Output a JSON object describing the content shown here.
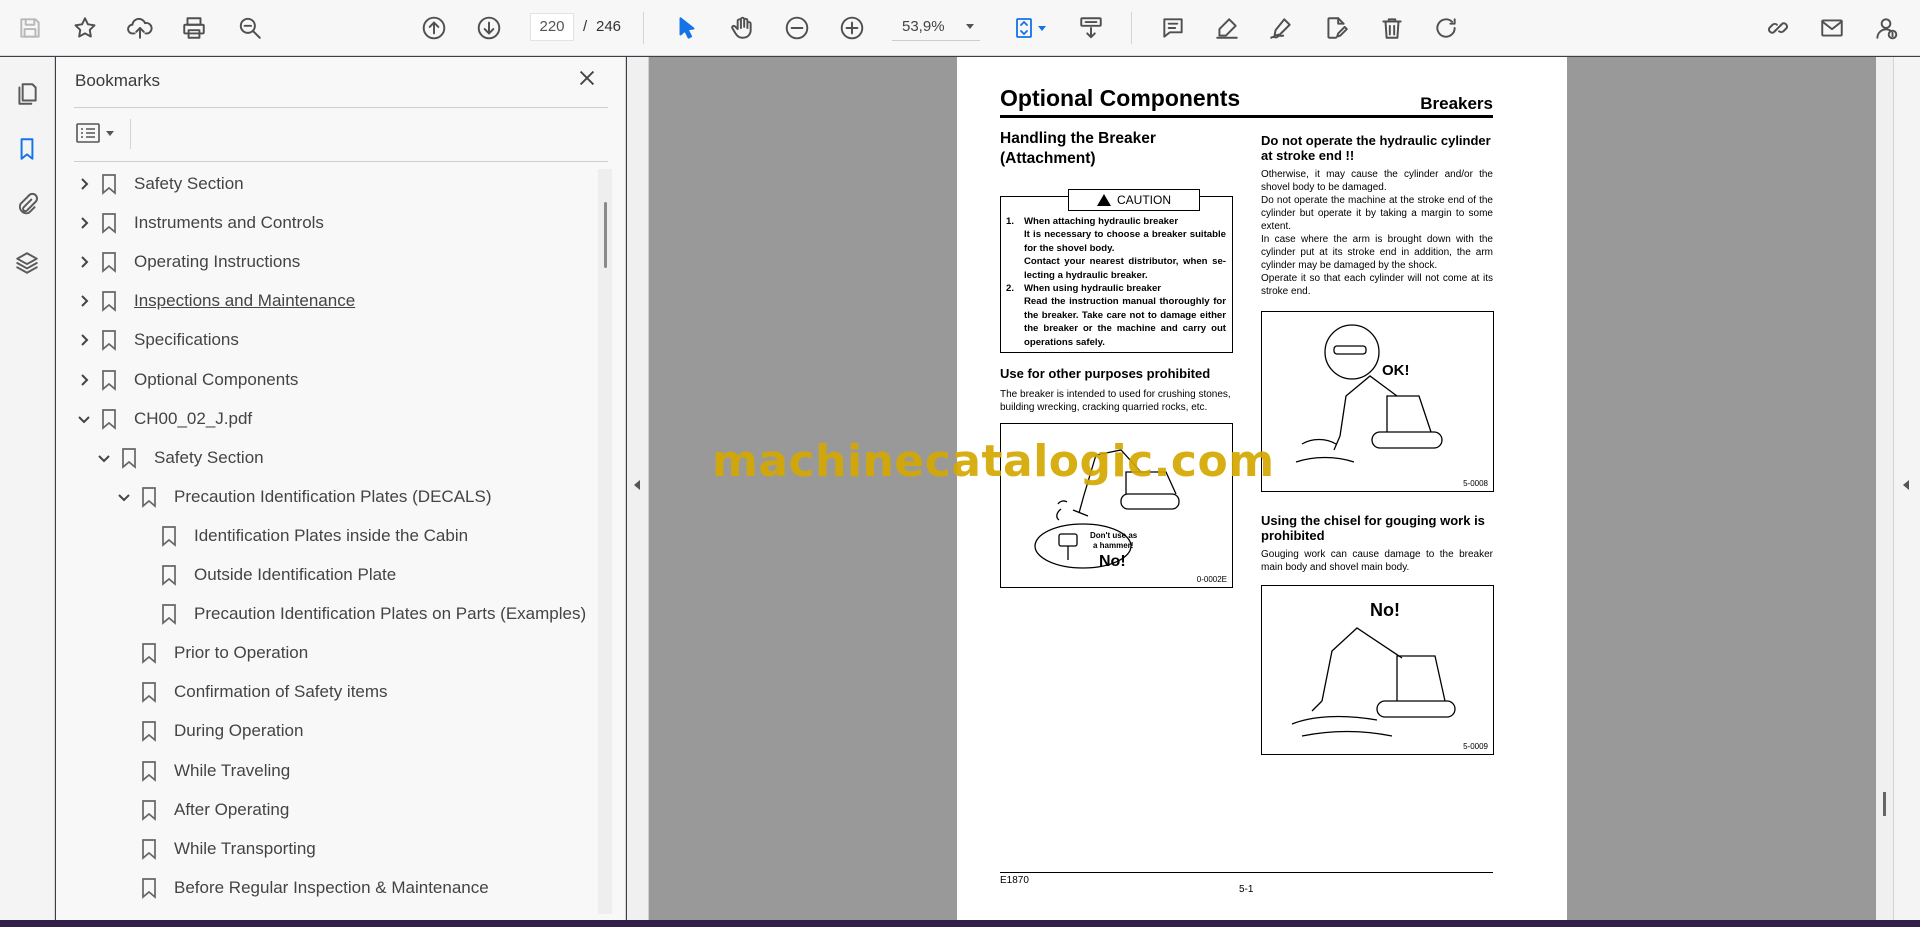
{
  "toolbar": {
    "page_current": "220",
    "page_separator": "/",
    "page_total": "246",
    "zoom": "53,9%"
  },
  "rail": {
    "icons": [
      "pages-icon",
      "bookmarks-icon",
      "attachments-icon",
      "layers-icon"
    ]
  },
  "bookmarks": {
    "title": "Bookmarks",
    "items": [
      {
        "label": "Safety Section",
        "level": 0,
        "state": "collapsed"
      },
      {
        "label": "Instruments and Controls",
        "level": 0,
        "state": "collapsed"
      },
      {
        "label": "Operating Instructions",
        "level": 0,
        "state": "collapsed"
      },
      {
        "label": "Inspections and Maintenance",
        "level": 0,
        "state": "collapsed",
        "underline": true
      },
      {
        "label": "Specifications",
        "level": 0,
        "state": "collapsed"
      },
      {
        "label": "Optional Components",
        "level": 0,
        "state": "collapsed"
      },
      {
        "label": "CH00_02_J.pdf",
        "level": 0,
        "state": "expanded"
      },
      {
        "label": "Safety Section",
        "level": 1,
        "state": "expanded"
      },
      {
        "label": "Precaution Identification Plates (DECALS)",
        "level": 2,
        "state": "expanded"
      },
      {
        "label": "Identification Plates inside the Cabin",
        "level": 3,
        "state": "leaf"
      },
      {
        "label": "Outside Identification Plate",
        "level": 3,
        "state": "leaf"
      },
      {
        "label": "Precaution Identification Plates on Parts (Examples)",
        "level": 3,
        "state": "leaf"
      },
      {
        "label": "Prior to Operation",
        "level": 2,
        "state": "leaf"
      },
      {
        "label": "Confirmation of Safety items",
        "level": 2,
        "state": "leaf"
      },
      {
        "label": "During Operation",
        "level": 2,
        "state": "leaf"
      },
      {
        "label": "While Traveling",
        "level": 2,
        "state": "leaf"
      },
      {
        "label": "After Operating",
        "level": 2,
        "state": "leaf"
      },
      {
        "label": "While Transporting",
        "level": 2,
        "state": "leaf"
      },
      {
        "label": "Before Regular Inspection & Maintenance",
        "level": 2,
        "state": "leaf"
      }
    ]
  },
  "page": {
    "title": "Optional Components",
    "section": "Breakers",
    "left": {
      "heading_line1": "Handling the Breaker",
      "heading_line2": "(Attachment)",
      "caution_label": "CAUTION",
      "caution_items": [
        {
          "n": "1.",
          "head": "When attaching hydraulic breaker",
          "lines": [
            "It is necessary to choose a breaker suitable for the shovel body.",
            "Contact your nearest distributor, when se-lecting a hydraulic breaker."
          ]
        },
        {
          "n": "2.",
          "head": "When using hydraulic breaker",
          "lines": [
            "Read the instruction manual thoroughly for the breaker. Take care not to damage either the breaker or the machine and carry out operations safely."
          ]
        }
      ],
      "sub_heading": "Use for other purposes prohibited",
      "sub_text": "The breaker is intended to used for crushing stones, building wrecking, cracking quarried rocks, etc.",
      "fig_text_1": "Don't use as",
      "fig_text_2": "a hammer!",
      "fig_text_no": "No!",
      "fig_code": "0-0002E"
    },
    "right": {
      "heading": "Do not operate the hydraulic cylinder at stroke end !!",
      "paragraphs": [
        "Otherwise, it may cause the cylinder and/or the shovel body to be damaged.",
        "Do not operate the machine at the stroke end of the cylinder but operate it by taking a margin to some extent.",
        "In case where the arm is brought down with the cylinder put at its stroke end in addition, the arm cylinder may be damaged by the shock.",
        "Operate it so that each cylinder will not come at its stroke end."
      ],
      "fig1_text": "OK!",
      "fig1_code": "5-0008",
      "heading2": "Using the chisel for gouging work is prohibited",
      "text2": "Gouging work can cause damage to the breaker main body and shovel main body.",
      "fig2_text": "No!",
      "fig2_code": "5-0009"
    },
    "footer_left": "E1870",
    "footer_center": "5-1"
  },
  "watermark": "machinecatalogic.com"
}
